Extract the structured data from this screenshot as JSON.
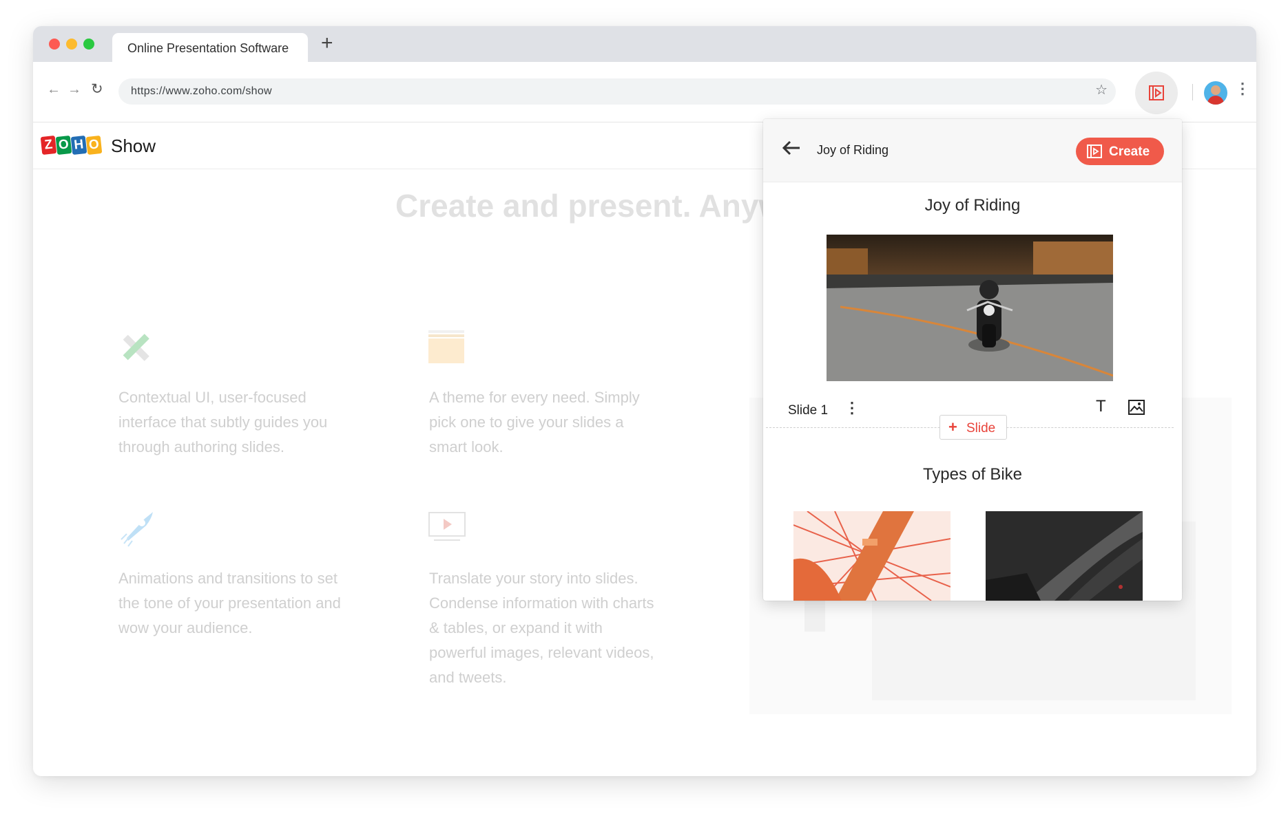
{
  "browser": {
    "tab_title": "Online Presentation Software",
    "new_tab_label": "+",
    "url": "https://www.zoho.com/show",
    "icons": [
      "back-arrow-icon",
      "forward-arrow-icon",
      "reload-icon",
      "bookmark-star-icon",
      "extension-icon",
      "profile-avatar",
      "menu-kebab-icon"
    ]
  },
  "zoho_page": {
    "logo_letters": [
      "Z",
      "O",
      "H",
      "O"
    ],
    "logo_colors": [
      "#e42527",
      "#089949",
      "#226db4",
      "#f9b21d"
    ],
    "product_name": "Show",
    "hero_text": "Create and present. Anyw",
    "features": [
      {
        "icon": "pencil-ruler-icon",
        "text": "Contextual UI, user-focused interface that subtly guides you through authoring slides."
      },
      {
        "icon": "folder-icon",
        "text": "A theme for every need. Simply pick one to give your slides a smart look."
      },
      {
        "icon": "rocket-icon",
        "text": "Animations and transitions to set the tone of your presentation and wow your audience."
      },
      {
        "icon": "play-screen-icon",
        "text": "Translate your story into slides. Condense information with charts & tables, or expand it with powerful images, relevant videos, and tweets."
      }
    ]
  },
  "panel": {
    "title": "Joy of Riding",
    "create_label": "Create",
    "slides": [
      {
        "heading": "Joy of Riding",
        "label": "Slide 1"
      },
      {
        "heading": "Types of Bike"
      }
    ],
    "add_slide_label": "Slide",
    "add_slide_plus": "+",
    "text_tool_glyph": "T",
    "accent_color": "#f05a4a"
  }
}
